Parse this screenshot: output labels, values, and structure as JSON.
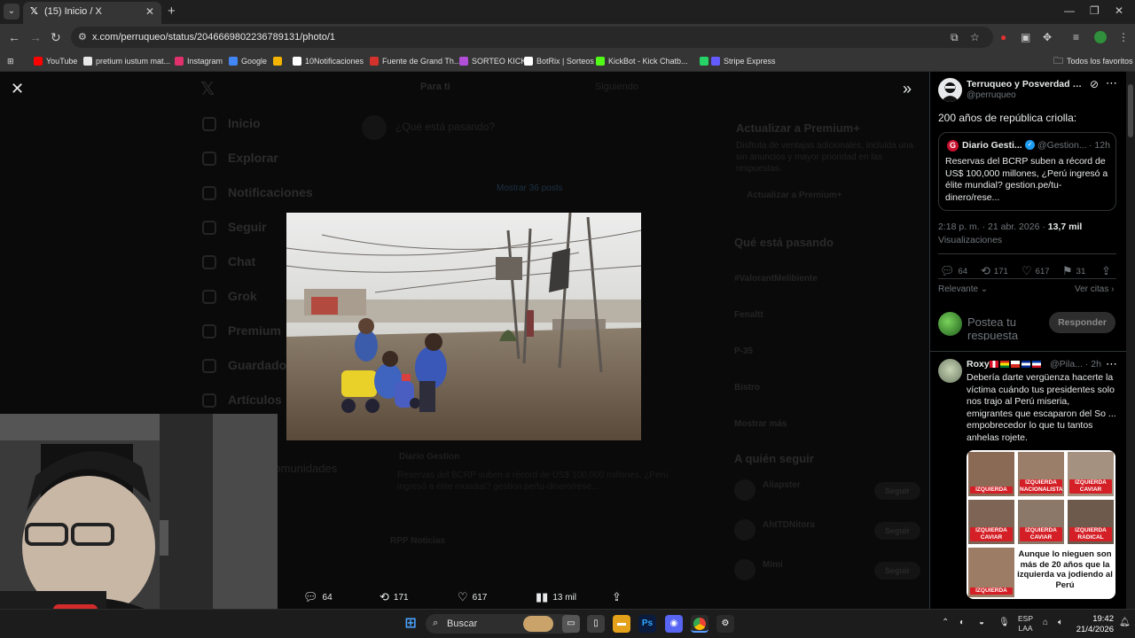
{
  "browser": {
    "tab_title": "(15) Inicio / X",
    "url": "x.com/perruqueo/status/2046669802236789131/photo/1",
    "bookmarks": [
      {
        "label": "YouTube",
        "color": "#ff0000"
      },
      {
        "label": "pretium iustum mat...",
        "color": "#e8e8e8"
      },
      {
        "label": "Instagram",
        "color": "#e1306c"
      },
      {
        "label": "Google",
        "color": "#4285f4"
      },
      {
        "label": "",
        "color": "#f4b400"
      },
      {
        "label": "10Notificaciones",
        "color": "#ffffff"
      },
      {
        "label": "Fuente de Grand Th...",
        "color": "#d6322d"
      },
      {
        "label": "SORTEO KICK",
        "color": "#b14fd8"
      },
      {
        "label": "BotRix | Sorteos",
        "color": "#ffffff"
      },
      {
        "label": "KickBot - Kick Chatb...",
        "color": "#53fc18"
      },
      {
        "label": "|",
        "color": "#25d366"
      },
      {
        "label": "Stripe Express",
        "color": "#635bff"
      }
    ],
    "all_bookmarks": "Todos los favoritos"
  },
  "background_page": {
    "tabs": [
      "Para ti",
      "Siguiendo"
    ],
    "nav": [
      "Inicio",
      "Explorar",
      "Notificaciones",
      "Seguir",
      "Chat",
      "Grok",
      "Premium",
      "Guardados",
      "Artículos"
    ],
    "nav_more": "Comunidades",
    "compose_placeholder": "¿Qué está pasando?",
    "show_posts": "Mostrar 36 posts",
    "premium_title": "Actualizar a Premium+",
    "premium_text": "Disfruta de ventajas adicionales, incluida una sin anuncios y mayor prioridad en las respuestas.",
    "premium_button": "Actualizar a Premium+",
    "trends_title": "Qué está pasando",
    "trends": [
      "#ValorantMelibiente",
      "Fenaltt",
      "P-35",
      "Bistro",
      "Mostrar más"
    ],
    "follow_title": "A quién seguir",
    "follow_button": "Seguir",
    "follow_list": [
      "Aliapster",
      "AhtTDNitora",
      "Mimi"
    ],
    "quoted_card_name": "Diario Gestion",
    "quoted_card_text": "Reservas del BCRP suben a récord de US$ 100,000 millones, ¿Perú ingresó a élite mundial? gestion.pe/tu-dinero/rese...",
    "rpp_name": "RPP Noticias"
  },
  "viewer": {
    "photo_alt": "Niños jugando en la tierra en un asentamiento con neblina",
    "stats": {
      "replies": "64",
      "reposts": "171",
      "likes": "617",
      "views": "13 mil"
    }
  },
  "tweet": {
    "author_name": "Terruqueo y Posverdad – ...",
    "author_handle": "@perruqueo",
    "text": "200 años de república criolla:",
    "quote": {
      "name": "Diario Gesti...",
      "handle": "@Gestion...",
      "time": "· 12h",
      "logo_letter": "G",
      "text": "Reservas del BCRP suben a récord de US$ 100,000 millones, ¿Perú ingresó a élite mundial? gestion.pe/tu-dinero/rese..."
    },
    "time": "2:18 p. m. · 21 abr. 2026 ·",
    "views_count": "13,7 mil",
    "views_label": "Visualizaciones",
    "stats": {
      "replies": "64",
      "reposts": "171",
      "likes": "617",
      "bookmarks": "31"
    },
    "sort": "Relevante",
    "quotes_link": "Ver citas",
    "reply_placeholder": "Postea tu respuesta",
    "reply_button": "Responder"
  },
  "reply": {
    "name": "Roxy",
    "handle": "@Pila...",
    "time": "· 2h",
    "text": "Debería darte vergüenza hacerte la víctima cuándo tus presidentes solo nos trajo al Perú miseria, emigrantes que escaparon del So ... empobrecedor lo que tu tantos anhelas rojete.",
    "meme_labels": [
      "IZQUIERDA",
      "IZQUIERDA NACIONALISTA",
      "IZQUIERDA CAVIAR",
      "IZQUIERDA CAVIAR",
      "IZQUIERDA CAVIAR",
      "IZQUIERDA RADICAL",
      "IZQUIERDA"
    ],
    "meme_caption": "Aunque lo nieguen son más de 20 años que la izquierda va jodiendo al Perú"
  },
  "taskbar": {
    "search_label": "Buscar",
    "lang_top": "ESP",
    "lang_bottom": "LAA",
    "time": "19:42",
    "date": "21/4/2026"
  }
}
